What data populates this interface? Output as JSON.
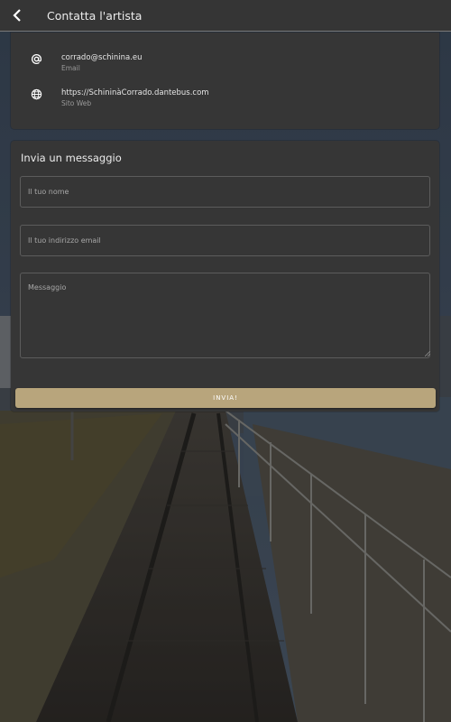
{
  "app_bar": {
    "title": "Contatta l'artista",
    "back_icon": "chevron-left-icon"
  },
  "contact": {
    "email": {
      "value": "corrado@schinina.eu",
      "label": "Email",
      "icon": "at-sign-icon"
    },
    "website": {
      "value": "https://SchininàCorrado.dantebus.com",
      "label": "Sito Web",
      "icon": "globe-icon"
    }
  },
  "form": {
    "title": "Invia un messaggio",
    "name_placeholder": "Il tuo nome",
    "email_placeholder": "Il tuo indirizzo email",
    "message_placeholder": "Messaggio",
    "submit_label": "INVIA!"
  },
  "colors": {
    "accent": "#b8a57c",
    "surface": "#363636",
    "appbar": "#353535"
  }
}
